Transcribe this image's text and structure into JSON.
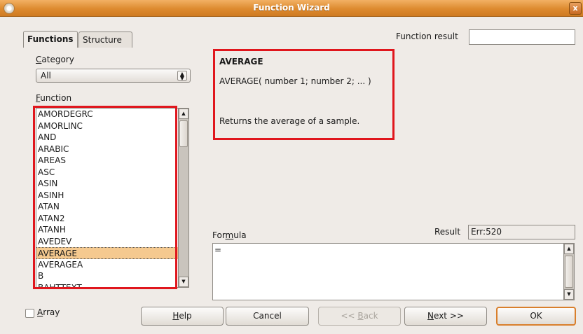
{
  "window": {
    "title": "Function Wizard",
    "close_glyph": "x"
  },
  "tabs": [
    {
      "label": "Functions",
      "active": true
    },
    {
      "label": "Structure",
      "active": false
    }
  ],
  "function_result": {
    "label": "Function result",
    "value": ""
  },
  "category": {
    "label_first": "C",
    "label_rest": "ategory",
    "selected": "All"
  },
  "function": {
    "label_first": "F",
    "label_rest": "unction",
    "items": [
      "AMORDEGRC",
      "AMORLINC",
      "AND",
      "ARABIC",
      "AREAS",
      "ASC",
      "ASIN",
      "ASINH",
      "ATAN",
      "ATAN2",
      "ATANH",
      "AVEDEV",
      "AVERAGE",
      "AVERAGEA",
      "B",
      "BAHTTEXT"
    ],
    "selected_index": 12
  },
  "description": {
    "name": "AVERAGE",
    "syntax": "AVERAGE( number 1; number 2; ...  )",
    "text": "Returns the average of a sample."
  },
  "formula": {
    "label_pre": "For",
    "label_u": "m",
    "label_post": "ula",
    "value": "="
  },
  "result": {
    "label": "Result",
    "value": "Err:520"
  },
  "array": {
    "label_first": "A",
    "label_rest": "rray",
    "checked": false
  },
  "buttons": {
    "help": {
      "first": "H",
      "rest": "elp"
    },
    "cancel": "Cancel",
    "back": {
      "pre": "<< ",
      "first": "B",
      "rest": "ack"
    },
    "next": {
      "first": "N",
      "rest": "ext >>"
    },
    "ok": "OK"
  },
  "colors": {
    "highlight": "#e0161d",
    "titlebar": "#dd8a2f",
    "selection": "#f5c98f"
  }
}
